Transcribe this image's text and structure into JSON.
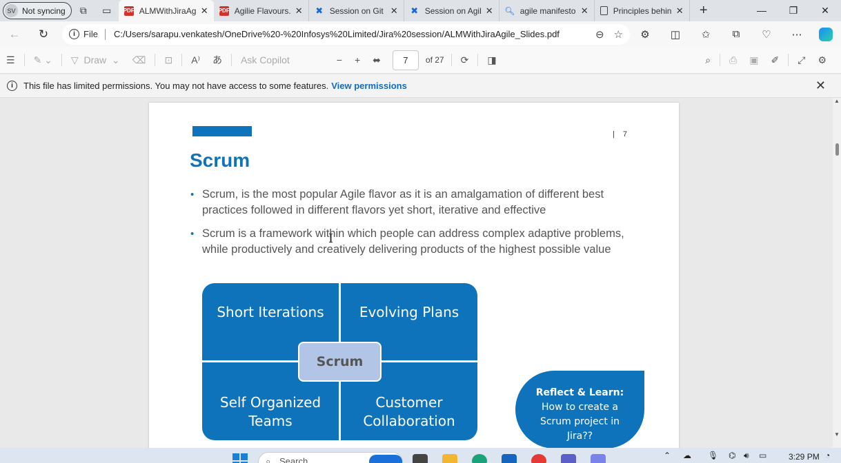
{
  "browser": {
    "profile": {
      "initials": "SV",
      "label": "Not syncing"
    },
    "tabs": [
      {
        "title": "ALMWithJiraAg",
        "icon": "pdf-icon",
        "active": true
      },
      {
        "title": "Agilie Flavours.",
        "icon": "pdf-icon",
        "active": false
      },
      {
        "title": "Session on Git",
        "icon": "confluence-icon",
        "active": false
      },
      {
        "title": "Session on Agil",
        "icon": "confluence-icon",
        "active": false
      },
      {
        "title": "agile manifesto",
        "icon": "search-icon",
        "active": false
      },
      {
        "title": "Principles behin",
        "icon": "document-icon",
        "active": false
      }
    ],
    "address": {
      "scheme_label": "File",
      "url": "C:/Users/sarapu.venkatesh/OneDrive%20-%20Infosys%20Limited/Jira%20session/ALMWithJiraAgile_Slides.pdf"
    }
  },
  "pdf_toolbar": {
    "draw_label": "Draw",
    "ask_copilot": "Ask Copilot",
    "current_page": "7",
    "page_count": "of 27"
  },
  "notice": {
    "message": "This file has limited permissions. You may not have access to some features.",
    "link": "View permissions"
  },
  "slide": {
    "page_number": "7",
    "title": "Scrum",
    "bullets": [
      "Scrum, is the most popular Agile flavor as it is an amalgamation of different best practices followed in different flavors yet short, iterative and effective",
      "Scrum  is a framework within which people can address complex adaptive problems, while productively and creatively delivering products of the highest possible value"
    ],
    "quadrants": [
      "Short Iterations",
      "Evolving Plans",
      "Self Organized Teams",
      "Customer Collaboration"
    ],
    "center_label": "Scrum",
    "reflect_title": "Reflect & Learn:",
    "reflect_body": "How to create a Scrum project in Jira??"
  },
  "taskbar": {
    "search_placeholder": "Search",
    "clock": "3:29 PM"
  },
  "colors": {
    "accent": "#0e73bb",
    "center_box": "#b2c5e6",
    "link": "#0f6cbd"
  }
}
